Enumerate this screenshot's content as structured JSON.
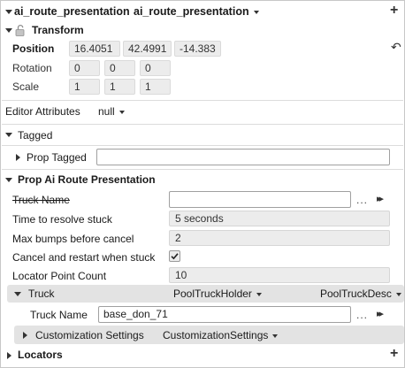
{
  "entity": {
    "name": "ai_route_presentation",
    "type_label": "ai_route_presentation"
  },
  "transform": {
    "title": "Transform",
    "position_label": "Position",
    "rotation_label": "Rotation",
    "scale_label": "Scale",
    "position": [
      "16.4051",
      "42.4991",
      "-14.383"
    ],
    "rotation": [
      "0",
      "0",
      "0"
    ],
    "scale": [
      "1",
      "1",
      "1"
    ]
  },
  "editor_attributes": {
    "label": "Editor Attributes",
    "value": "null"
  },
  "tagged": {
    "title": "Tagged",
    "prop_tagged_label": "Prop Tagged",
    "prop_tagged_value": ""
  },
  "presentation": {
    "title": "Prop Ai Route Presentation",
    "truck_name_label": "Truck Name",
    "truck_name_value": "",
    "time_to_resolve_label": "Time to resolve stuck",
    "time_to_resolve_value": "5 seconds",
    "max_bumps_label": "Max bumps before cancel",
    "max_bumps_value": "2",
    "cancel_restart_label": "Cancel and restart when stuck",
    "cancel_restart_checked": true,
    "locator_count_label": "Locator Point Count",
    "locator_count_value": "10",
    "more_label": "...",
    "truck": {
      "label": "Truck",
      "holder_type": "PoolTruckHolder",
      "desc_type": "PoolTruckDesc",
      "name_label": "Truck Name",
      "name_value": "base_don_71"
    },
    "customization": {
      "label": "Customization Settings",
      "type": "CustomizationSettings"
    }
  },
  "locators": {
    "title": "Locators"
  },
  "icons": {
    "add": "+",
    "reset": "↶",
    "checkmark": "✓",
    "double_chevron": "»"
  },
  "colors": {
    "sub_header_bg": "#e3e3e3",
    "field_bg": "#ececec",
    "border": "#c8c8c8"
  }
}
